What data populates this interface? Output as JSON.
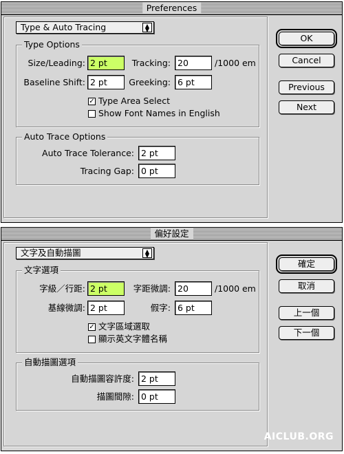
{
  "english": {
    "window_title": "Preferences",
    "section_dropdown": "Type & Auto Tracing",
    "type_options": {
      "title": "Type Options",
      "size_leading_label": "Size/Leading:",
      "size_leading_value": "2 pt",
      "tracking_label": "Tracking:",
      "tracking_value": "20",
      "tracking_unit": "/1000 em",
      "baseline_shift_label": "Baseline Shift:",
      "baseline_shift_value": "2 pt",
      "greeking_label": "Greeking:",
      "greeking_value": "6 pt",
      "type_area_select_label": "Type Area Select",
      "type_area_select_checked": true,
      "show_font_names_label": "Show Font Names in English",
      "show_font_names_checked": false
    },
    "auto_trace_options": {
      "title": "Auto Trace Options",
      "tolerance_label": "Auto Trace Tolerance:",
      "tolerance_value": "2 pt",
      "tracing_gap_label": "Tracing Gap:",
      "tracing_gap_value": "0 pt"
    },
    "buttons": {
      "ok": "OK",
      "cancel": "Cancel",
      "previous": "Previous",
      "next": "Next"
    }
  },
  "chinese": {
    "window_title": "偏好設定",
    "section_dropdown": "文字及自動描圖",
    "type_options": {
      "title": "文字選項",
      "size_leading_label": "字級／行距:",
      "size_leading_value": "2 pt",
      "tracking_label": "字距微調:",
      "tracking_value": "20",
      "tracking_unit": "/1000 em",
      "baseline_shift_label": "基線微調:",
      "baseline_shift_value": "2 pt",
      "greeking_label": "假字:",
      "greeking_value": "6 pt",
      "type_area_select_label": "文字區域選取",
      "type_area_select_checked": true,
      "show_font_names_label": "顯示英文字體名稱",
      "show_font_names_checked": false
    },
    "auto_trace_options": {
      "title": "自動描圖選項",
      "tolerance_label": "自動描圖容許度:",
      "tolerance_value": "2 pt",
      "tracing_gap_label": "描圖間隙:",
      "tracing_gap_value": "0 pt"
    },
    "buttons": {
      "ok": "確定",
      "cancel": "取消",
      "previous": "上一個",
      "next": "下一個"
    }
  },
  "watermark": "AICLUB.ORG",
  "colors": {
    "dialog_bg": "#d6d6d6",
    "highlight_field": "#ccff66"
  }
}
